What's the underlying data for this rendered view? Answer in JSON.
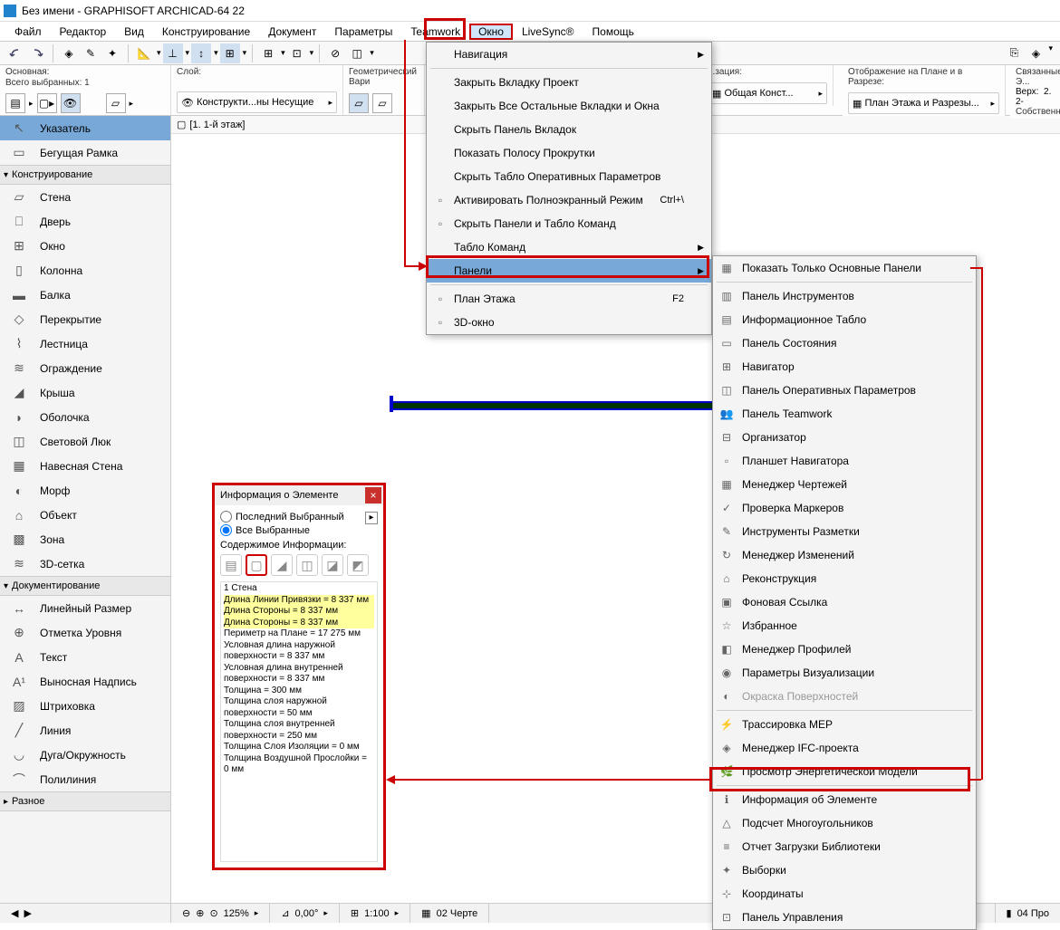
{
  "title": "Без имени - GRAPHISOFT ARCHICAD-64 22",
  "menu": [
    "Файл",
    "Редактор",
    "Вид",
    "Конструирование",
    "Документ",
    "Параметры",
    "Teamwork",
    "Окно",
    "LiveSync®",
    "Помощь"
  ],
  "menu_highlight_index": 7,
  "info_sections": {
    "sec1": {
      "label1": "Основная:",
      "label2": "Всего выбранных: 1"
    },
    "sec2": {
      "label": "Слой:",
      "value": "Конструкти...ны Несущие"
    },
    "sec3": {
      "label": "Геометрический Вари"
    },
    "sec4": {
      "label": "...зация:",
      "value": "Общая Конст..."
    },
    "sec5": {
      "label": "Отображение на Плане и в Разрезе:",
      "value": "План Этажа и Разрезы..."
    },
    "sec6": {
      "label": "Связанные Э...",
      "label2": "Верх:",
      "value": "2. 2-",
      "label3": "Собственный"
    }
  },
  "canvas_tab": "[1. 1-й этаж]",
  "toolbox": {
    "top": [
      {
        "label": "Указатель",
        "sel": true,
        "icon": "pointer"
      },
      {
        "label": "Бегущая Рамка",
        "sel": false,
        "icon": "marquee"
      }
    ],
    "group_constr": "Конструирование",
    "constr": [
      {
        "label": "Стена",
        "icon": "wall"
      },
      {
        "label": "Дверь",
        "icon": "door"
      },
      {
        "label": "Окно",
        "icon": "window"
      },
      {
        "label": "Колонна",
        "icon": "column"
      },
      {
        "label": "Балка",
        "icon": "beam"
      },
      {
        "label": "Перекрытие",
        "icon": "slab"
      },
      {
        "label": "Лестница",
        "icon": "stair"
      },
      {
        "label": "Ограждение",
        "icon": "railing"
      },
      {
        "label": "Крыша",
        "icon": "roof"
      },
      {
        "label": "Оболочка",
        "icon": "shell"
      },
      {
        "label": "Световой Люк",
        "icon": "skylight"
      },
      {
        "label": "Навесная Стена",
        "icon": "curtain"
      },
      {
        "label": "Морф",
        "icon": "morph"
      },
      {
        "label": "Объект",
        "icon": "object"
      },
      {
        "label": "Зона",
        "icon": "zone"
      },
      {
        "label": "3D-сетка",
        "icon": "mesh"
      }
    ],
    "group_doc": "Документирование",
    "doc": [
      {
        "label": "Линейный Размер",
        "icon": "dim"
      },
      {
        "label": "Отметка Уровня",
        "icon": "level"
      },
      {
        "label": "Текст",
        "icon": "text"
      },
      {
        "label": "Выносная Надпись",
        "icon": "label"
      },
      {
        "label": "Штриховка",
        "icon": "hatch"
      },
      {
        "label": "Линия",
        "icon": "line"
      },
      {
        "label": "Дуга/Окружность",
        "icon": "arc"
      },
      {
        "label": "Полилиния",
        "icon": "polyline"
      }
    ],
    "group_misc": "Разное"
  },
  "window_menu": [
    {
      "label": "Навигация",
      "sub": true
    },
    {
      "sep": true
    },
    {
      "label": "Закрыть Вкладку Проект"
    },
    {
      "label": "Закрыть Все Остальные Вкладки и Окна"
    },
    {
      "label": "Скрыть Панель Вкладок"
    },
    {
      "label": "Показать Полосу Прокрутки"
    },
    {
      "label": "Скрыть Табло Оперативных Параметров"
    },
    {
      "label": "Активировать Полноэкранный Режим",
      "sc": "Ctrl+\\",
      "icon": "fullscreen"
    },
    {
      "label": "Скрыть Панели и Табло Команд",
      "icon": "panels"
    },
    {
      "label": "Табло Команд",
      "sub": true
    },
    {
      "label": "Панели",
      "sub": true,
      "sel": true
    },
    {
      "sep": true
    },
    {
      "label": "План Этажа",
      "sc": "F2",
      "icon": "plan"
    },
    {
      "label": "3D-окно",
      "icon": "3d"
    }
  ],
  "panels_submenu": [
    {
      "label": "Показать Только Основные Панели",
      "icon": "grid"
    },
    {
      "sep": true
    },
    {
      "label": "Панель Инструментов",
      "icon": "tools"
    },
    {
      "label": "Информационное Табло",
      "icon": "info"
    },
    {
      "label": "Панель Состояния",
      "icon": "status"
    },
    {
      "label": "Навигатор",
      "icon": "nav"
    },
    {
      "label": "Панель Оперативных Параметров",
      "icon": "quick"
    },
    {
      "label": "Панель Teamwork",
      "icon": "team"
    },
    {
      "label": "Организатор",
      "icon": "org"
    },
    {
      "label": "Планшет Навигатора",
      "icon": "navprev"
    },
    {
      "label": "Менеджер Чертежей",
      "icon": "draw"
    },
    {
      "label": "Проверка Маркеров",
      "icon": "marker"
    },
    {
      "label": "Инструменты Разметки",
      "icon": "markup"
    },
    {
      "label": "Менеджер Изменений",
      "icon": "change"
    },
    {
      "label": "Реконструкция",
      "icon": "renov"
    },
    {
      "label": "Фоновая Ссылка",
      "icon": "trace"
    },
    {
      "label": "Избранное",
      "icon": "fav"
    },
    {
      "label": "Менеджер Профилей",
      "icon": "profile"
    },
    {
      "label": "Параметры Визуализации",
      "icon": "render"
    },
    {
      "label": "Окраска Поверхностей",
      "icon": "surf",
      "greyed": true
    },
    {
      "sep": true
    },
    {
      "label": "Трассировка MEP",
      "icon": "mep"
    },
    {
      "label": "Менеджер IFC-проекта",
      "icon": "ifc"
    },
    {
      "label": "Просмотр Энергетической Модели",
      "icon": "energy"
    },
    {
      "sep": true
    },
    {
      "label": "Информация об Элементе",
      "icon": "eleminfo",
      "hl": true
    },
    {
      "label": "Подсчет Многоугольников",
      "icon": "poly"
    },
    {
      "label": "Отчет Загрузки Библиотеки",
      "icon": "lib"
    },
    {
      "label": "Выборки",
      "icon": "sel"
    },
    {
      "label": "Координаты",
      "icon": "coord"
    },
    {
      "label": "Панель Управления",
      "icon": "ctrl"
    }
  ],
  "elem_info": {
    "title": "Информация о Элементе",
    "radio1": "Последний Выбранный",
    "radio2": "Все Выбранные",
    "content_label": "Содержимое Информации:",
    "list_header": "1 Стена",
    "lines": [
      {
        "t": "Длина Линии Привязки = 8 337 мм",
        "hl": true
      },
      {
        "t": "Длина Стороны = 8 337 мм",
        "hl": true
      },
      {
        "t": "Длина Стороны = 8 337 мм",
        "hl": true
      },
      {
        "t": "Периметр на Плане = 17 275 мм",
        "hl": false
      },
      {
        "t": "Условная длина наружной поверхности = 8 337 мм",
        "hl": false
      },
      {
        "t": "Условная длина внутренней поверхности = 8 337 мм",
        "hl": false
      },
      {
        "t": "Толщина = 300 мм",
        "hl": false
      },
      {
        "t": "Толщина слоя наружной поверхности = 50 мм",
        "hl": false
      },
      {
        "t": "Толщина слоя внутренней поверхности = 250 мм",
        "hl": false
      },
      {
        "t": "Толщина Слоя Изоляции = 0 мм",
        "hl": false
      },
      {
        "t": "Толщина Воздушной Прослойки = 0 мм",
        "hl": false
      }
    ]
  },
  "status": {
    "zoom": "125%",
    "angle": "0,00°",
    "scale": "1:100",
    "layer": "02 Черте",
    "layout": "04 Про"
  }
}
